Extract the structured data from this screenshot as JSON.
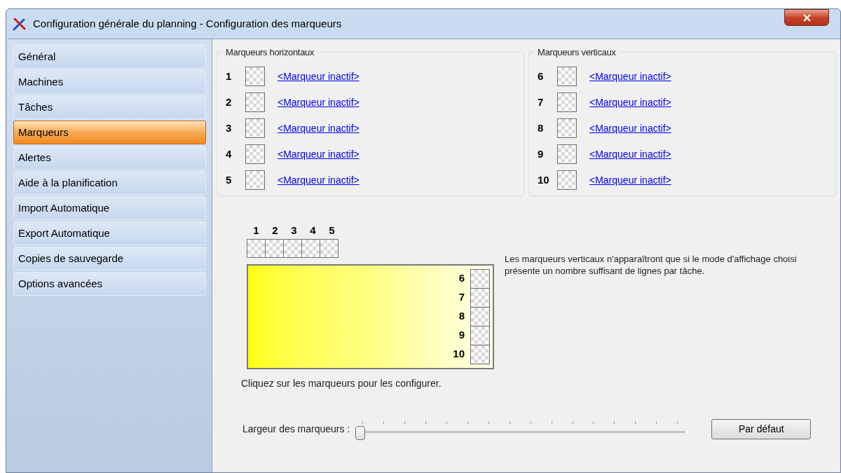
{
  "window": {
    "title": "Configuration générale du planning - Configuration des marqueurs"
  },
  "sidebar": {
    "items": [
      {
        "label": "Général",
        "selected": false
      },
      {
        "label": "Machines",
        "selected": false
      },
      {
        "label": "Tâches",
        "selected": false
      },
      {
        "label": "Marqueurs",
        "selected": true
      },
      {
        "label": "Alertes",
        "selected": false
      },
      {
        "label": "Aide à la planification",
        "selected": false
      },
      {
        "label": "Import Automatique",
        "selected": false
      },
      {
        "label": "Export Automatique",
        "selected": false
      },
      {
        "label": "Copies de sauvegarde",
        "selected": false
      },
      {
        "label": "Options avancées",
        "selected": false
      }
    ]
  },
  "groups": [
    {
      "title": "Marqueurs horizontaux",
      "markers": [
        {
          "number": "1",
          "link": "<Marqueur inactif>"
        },
        {
          "number": "2",
          "link": "<Marqueur inactif>"
        },
        {
          "number": "3",
          "link": "<Marqueur inactif>"
        },
        {
          "number": "4",
          "link": "<Marqueur inactif>"
        },
        {
          "number": "5",
          "link": "<Marqueur inactif>"
        }
      ]
    },
    {
      "title": "Marqueurs verticaux",
      "markers": [
        {
          "number": "6",
          "link": "<Marqueur inactif>"
        },
        {
          "number": "7",
          "link": "<Marqueur inactif>"
        },
        {
          "number": "8",
          "link": "<Marqueur inactif>"
        },
        {
          "number": "9",
          "link": "<Marqueur inactif>"
        },
        {
          "number": "10",
          "link": "<Marqueur inactif>"
        }
      ]
    }
  ],
  "preview": {
    "top_numbers": [
      "1",
      "2",
      "3",
      "4",
      "5"
    ],
    "side_numbers": [
      "6",
      "7",
      "8",
      "9",
      "10"
    ],
    "caption": "Cliquez sur les marqueurs pour les configurer."
  },
  "note": "Les marqueurs verticaux n'apparaîtront que si le mode d'affichage choisi présente un nombre suffisant de lignes par tâche.",
  "slider": {
    "label": "Largeur des marqueurs :",
    "level": 0
  },
  "default_button": "Par défaut"
}
